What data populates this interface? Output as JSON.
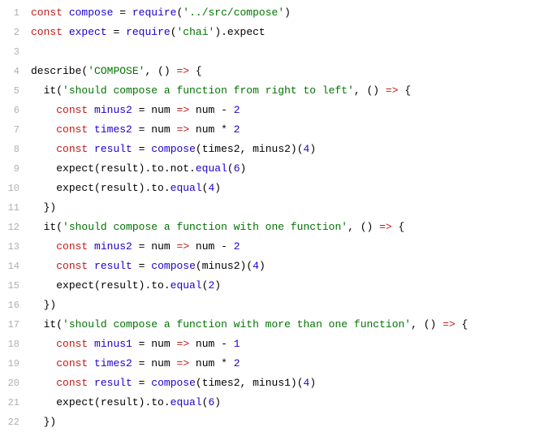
{
  "lines": [
    {
      "num": "1",
      "tokens": [
        [
          "kw",
          "const"
        ],
        [
          "punc",
          " "
        ],
        [
          "fn-name",
          "compose"
        ],
        [
          "punc",
          " "
        ],
        [
          "op",
          "="
        ],
        [
          "punc",
          " "
        ],
        [
          "builtin",
          "require"
        ],
        [
          "punc",
          "("
        ],
        [
          "str",
          "'../src/compose'"
        ],
        [
          "punc",
          ")"
        ]
      ]
    },
    {
      "num": "2",
      "tokens": [
        [
          "kw",
          "const"
        ],
        [
          "punc",
          " "
        ],
        [
          "fn-name",
          "expect"
        ],
        [
          "punc",
          " "
        ],
        [
          "op",
          "="
        ],
        [
          "punc",
          " "
        ],
        [
          "builtin",
          "require"
        ],
        [
          "punc",
          "("
        ],
        [
          "str",
          "'chai'"
        ],
        [
          "punc",
          ")."
        ],
        [
          "ident",
          "expect"
        ]
      ]
    },
    {
      "num": "3",
      "tokens": []
    },
    {
      "num": "4",
      "tokens": [
        [
          "ident",
          "describe"
        ],
        [
          "punc",
          "("
        ],
        [
          "str",
          "'COMPOSE'"
        ],
        [
          "punc",
          ", () "
        ],
        [
          "arrow",
          "=>"
        ],
        [
          "punc",
          " {"
        ]
      ]
    },
    {
      "num": "5",
      "tokens": [
        [
          "punc",
          "  "
        ],
        [
          "ident",
          "it"
        ],
        [
          "punc",
          "("
        ],
        [
          "str",
          "'should compose a function from right to left'"
        ],
        [
          "punc",
          ", () "
        ],
        [
          "arrow",
          "=>"
        ],
        [
          "punc",
          " {"
        ]
      ]
    },
    {
      "num": "6",
      "tokens": [
        [
          "punc",
          "    "
        ],
        [
          "kw",
          "const"
        ],
        [
          "punc",
          " "
        ],
        [
          "fn-name",
          "minus2"
        ],
        [
          "punc",
          " "
        ],
        [
          "op",
          "="
        ],
        [
          "punc",
          " "
        ],
        [
          "param",
          "num"
        ],
        [
          "punc",
          " "
        ],
        [
          "arrow",
          "=>"
        ],
        [
          "punc",
          " num "
        ],
        [
          "op",
          "-"
        ],
        [
          "punc",
          " "
        ],
        [
          "num",
          "2"
        ]
      ]
    },
    {
      "num": "7",
      "tokens": [
        [
          "punc",
          "    "
        ],
        [
          "kw",
          "const"
        ],
        [
          "punc",
          " "
        ],
        [
          "fn-name",
          "times2"
        ],
        [
          "punc",
          " "
        ],
        [
          "op",
          "="
        ],
        [
          "punc",
          " "
        ],
        [
          "param",
          "num"
        ],
        [
          "punc",
          " "
        ],
        [
          "arrow",
          "=>"
        ],
        [
          "punc",
          " num "
        ],
        [
          "op",
          "*"
        ],
        [
          "punc",
          " "
        ],
        [
          "num",
          "2"
        ]
      ]
    },
    {
      "num": "8",
      "tokens": [
        [
          "punc",
          "    "
        ],
        [
          "kw",
          "const"
        ],
        [
          "punc",
          " "
        ],
        [
          "fn-name",
          "result"
        ],
        [
          "punc",
          " "
        ],
        [
          "op",
          "="
        ],
        [
          "punc",
          " "
        ],
        [
          "builtin",
          "compose"
        ],
        [
          "punc",
          "(times2, minus2)("
        ],
        [
          "num",
          "4"
        ],
        [
          "punc",
          ")"
        ]
      ]
    },
    {
      "num": "9",
      "tokens": [
        [
          "punc",
          "    "
        ],
        [
          "ident",
          "expect"
        ],
        [
          "punc",
          "(result).to.not."
        ],
        [
          "builtin",
          "equal"
        ],
        [
          "punc",
          "("
        ],
        [
          "num",
          "6"
        ],
        [
          "punc",
          ")"
        ]
      ]
    },
    {
      "num": "10",
      "tokens": [
        [
          "punc",
          "    "
        ],
        [
          "ident",
          "expect"
        ],
        [
          "punc",
          "(result).to."
        ],
        [
          "builtin",
          "equal"
        ],
        [
          "punc",
          "("
        ],
        [
          "num",
          "4"
        ],
        [
          "punc",
          ")"
        ]
      ]
    },
    {
      "num": "11",
      "tokens": [
        [
          "punc",
          "  })"
        ]
      ]
    },
    {
      "num": "12",
      "tokens": [
        [
          "punc",
          "  "
        ],
        [
          "ident",
          "it"
        ],
        [
          "punc",
          "("
        ],
        [
          "str",
          "'should compose a function with one function'"
        ],
        [
          "punc",
          ", () "
        ],
        [
          "arrow",
          "=>"
        ],
        [
          "punc",
          " {"
        ]
      ]
    },
    {
      "num": "13",
      "tokens": [
        [
          "punc",
          "    "
        ],
        [
          "kw",
          "const"
        ],
        [
          "punc",
          " "
        ],
        [
          "fn-name",
          "minus2"
        ],
        [
          "punc",
          " "
        ],
        [
          "op",
          "="
        ],
        [
          "punc",
          " "
        ],
        [
          "param",
          "num"
        ],
        [
          "punc",
          " "
        ],
        [
          "arrow",
          "=>"
        ],
        [
          "punc",
          " num "
        ],
        [
          "op",
          "-"
        ],
        [
          "punc",
          " "
        ],
        [
          "num",
          "2"
        ]
      ]
    },
    {
      "num": "14",
      "tokens": [
        [
          "punc",
          "    "
        ],
        [
          "kw",
          "const"
        ],
        [
          "punc",
          " "
        ],
        [
          "fn-name",
          "result"
        ],
        [
          "punc",
          " "
        ],
        [
          "op",
          "="
        ],
        [
          "punc",
          " "
        ],
        [
          "builtin",
          "compose"
        ],
        [
          "punc",
          "(minus2)("
        ],
        [
          "num",
          "4"
        ],
        [
          "punc",
          ")"
        ]
      ]
    },
    {
      "num": "15",
      "tokens": [
        [
          "punc",
          "    "
        ],
        [
          "ident",
          "expect"
        ],
        [
          "punc",
          "(result).to."
        ],
        [
          "builtin",
          "equal"
        ],
        [
          "punc",
          "("
        ],
        [
          "num",
          "2"
        ],
        [
          "punc",
          ")"
        ]
      ]
    },
    {
      "num": "16",
      "tokens": [
        [
          "punc",
          "  })"
        ]
      ]
    },
    {
      "num": "17",
      "tokens": [
        [
          "punc",
          "  "
        ],
        [
          "ident",
          "it"
        ],
        [
          "punc",
          "("
        ],
        [
          "str",
          "'should compose a function with more than one function'"
        ],
        [
          "punc",
          ", () "
        ],
        [
          "arrow",
          "=>"
        ],
        [
          "punc",
          " {"
        ]
      ]
    },
    {
      "num": "18",
      "tokens": [
        [
          "punc",
          "    "
        ],
        [
          "kw",
          "const"
        ],
        [
          "punc",
          " "
        ],
        [
          "fn-name",
          "minus1"
        ],
        [
          "punc",
          " "
        ],
        [
          "op",
          "="
        ],
        [
          "punc",
          " "
        ],
        [
          "param",
          "num"
        ],
        [
          "punc",
          " "
        ],
        [
          "arrow",
          "=>"
        ],
        [
          "punc",
          " num "
        ],
        [
          "op",
          "-"
        ],
        [
          "punc",
          " "
        ],
        [
          "num",
          "1"
        ]
      ]
    },
    {
      "num": "19",
      "tokens": [
        [
          "punc",
          "    "
        ],
        [
          "kw",
          "const"
        ],
        [
          "punc",
          " "
        ],
        [
          "fn-name",
          "times2"
        ],
        [
          "punc",
          " "
        ],
        [
          "op",
          "="
        ],
        [
          "punc",
          " "
        ],
        [
          "param",
          "num"
        ],
        [
          "punc",
          " "
        ],
        [
          "arrow",
          "=>"
        ],
        [
          "punc",
          " num "
        ],
        [
          "op",
          "*"
        ],
        [
          "punc",
          " "
        ],
        [
          "num",
          "2"
        ]
      ]
    },
    {
      "num": "20",
      "tokens": [
        [
          "punc",
          "    "
        ],
        [
          "kw",
          "const"
        ],
        [
          "punc",
          " "
        ],
        [
          "fn-name",
          "result"
        ],
        [
          "punc",
          " "
        ],
        [
          "op",
          "="
        ],
        [
          "punc",
          " "
        ],
        [
          "builtin",
          "compose"
        ],
        [
          "punc",
          "(times2, minus1)("
        ],
        [
          "num",
          "4"
        ],
        [
          "punc",
          ")"
        ]
      ]
    },
    {
      "num": "21",
      "tokens": [
        [
          "punc",
          "    "
        ],
        [
          "ident",
          "expect"
        ],
        [
          "punc",
          "(result).to."
        ],
        [
          "builtin",
          "equal"
        ],
        [
          "punc",
          "("
        ],
        [
          "num",
          "6"
        ],
        [
          "punc",
          ")"
        ]
      ]
    },
    {
      "num": "22",
      "tokens": [
        [
          "punc",
          "  })"
        ]
      ]
    }
  ]
}
